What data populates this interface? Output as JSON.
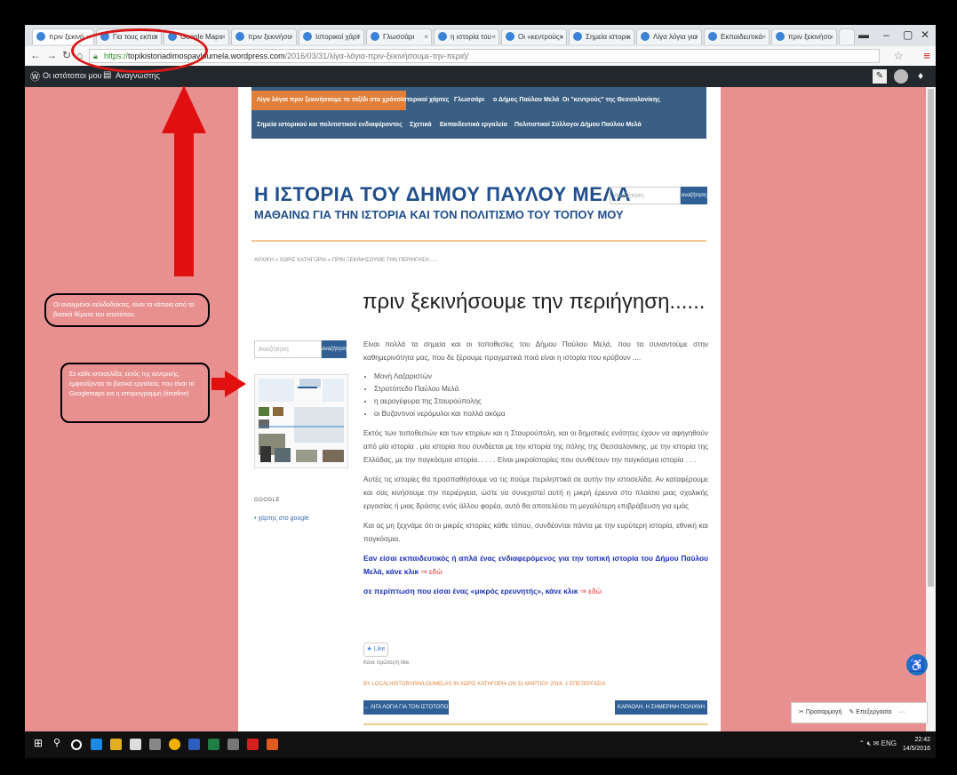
{
  "browser": {
    "tabs": [
      {
        "label": "πριν ξεκινή"
      },
      {
        "label": "Για τους εκπαι"
      },
      {
        "label": "Google Maps"
      },
      {
        "label": "πριν ξεκινήσο"
      },
      {
        "label": "Ιστορικοί χάρτ"
      },
      {
        "label": "Γλωσσάρι"
      },
      {
        "label": "η ιστορία του"
      },
      {
        "label": "Οι «κεντρούς»"
      },
      {
        "label": "Σημεία ιστορικ"
      },
      {
        "label": "Λίγα λόγια για"
      },
      {
        "label": "Εκπαιδευτικά"
      },
      {
        "label": "πριν ξεκινήσο"
      }
    ],
    "url_scheme": "https://",
    "url_host": "topikistoriadimospavloumela.wordpress.com",
    "url_path": "/2016/03/31/λίγα-λόγια-πριν-ξεκινήσουμε-την-περιή/"
  },
  "wpbar": {
    "my_sites": "Οι ιστότοποι μου",
    "reader": "Αναγνώστης"
  },
  "site": {
    "nav_row1": [
      "Λίγα λόγια πριν ξεκινήσουμε το ταξίδι στο χρόνο",
      "Ιστορικοί χάρτες",
      "Γλωσσάρι",
      "ο Δήμος Παύλου Μελά",
      "Οι \"κεντρούς\" της Θεσσαλονίκης"
    ],
    "nav_row2": [
      "Σημεία ιστορικού και πολιτιστικού ενδιαφέροντος",
      "Σχετικά",
      "Εκπαιδευτικά εργαλεία",
      "Πολιτιστικοί Σύλλογοι Δήμου Παύλου Μελά"
    ],
    "title": "Η ΙΣΤΟΡΙΑ ΤΟΥ ΔΗΜΟΥ ΠΑΥΛΟΥ ΜΕΛΑ",
    "tagline": "ΜΑΘΑΙΝΩ ΓΙΑ ΤΗΝ ΙΣΤΟΡΙΑ ΚΑΙ ΤΟΝ ΠΟΛΙΤΙΣΜΟ ΤΟΥ ΤΟΠΟΥ ΜΟΥ",
    "search_placeholder": "Αναζήτηση",
    "search_button": "αναζήτηση",
    "breadcrumb": "ΑΡΧΙΚΗ » ΧΩΡΙΣ ΚΑΤΗΓΟΡΙΑ » ΠΡΙΝ ΞΕΚΙΝΗΣΟΥΜΕ ΤΗΝ ΠΕΡΙΗΓΗΣΗ......"
  },
  "sidebar": {
    "search_placeholder": "Αναζήτηση",
    "search_button": "αναζήτηση",
    "google_heading": "GOOGLE",
    "google_link": "χάρτης στο google"
  },
  "post": {
    "title": "πριν ξεκινήσουμε την περιήγηση......",
    "p1": "Είναι πολλά τα σημεία και οι τοποθεσίες του Δήμου Παύλου Μελά, που τα συναντούμε στην καθημερινότητα μας, που δε ξέρουμε πραγματικά ποιά είναι η ιστορία που κρύβουν ....",
    "list": [
      "Μονή Λαζαριστών",
      "Στρατόπεδο Παύλου Μελά",
      "η αερογέφυρα της Σταυρούπολης",
      "οι Βυζαντινοί νερόμυλοι και πολλά ακόμα"
    ],
    "p2": "Εκτός των τοποθεσιών και των κτηρίων και η Σταυρούπολη, και οι δημοτικές ενότητες έχουν να αφηγηθούν από μία ιστορία . μία ιστορία που συνδέεται με την ιστορία της πόλης της Θεσσαλονίκης, με την ιστορία της Ελλάδας, με την παγκόσμια ιστορία. . . . . Είναι μικροϊστορίες που συνθέτουν την παγκόσμια ιστορία . . .",
    "p3": "Αυτές τις ιστορίες θα προσπαθήσουμε να τις πούμε περιληπτικά σε αυτήν την ιστοσελίδα. Αν καταφέρουμε και σας κινήσουμε την περιέργεια, ώστε να συνεχιστεί αυτή η μικρή έρευνα στο πλαίσιο μιας σχολικής εργασίας ή μιας δράσης ενός άλλου φορέα, αυτό θα αποτελέσει τη μεγαλύτερη επιβράβευση για εμάς",
    "p4": "Και ας μη ξεχνάμε ότι οι μικρές ιστορίες κάθε τόπου, συνδέονται πάντα με την ευρύτερη ιστορία, εθνική και παγκόσμια.",
    "cta1": "Εαν είσαι εκπαιδευτικός ή απλά ένας ενδιαφερόμενος για την τοπική ιστορία του Δήμου Παύλου Μελά, κάνε κλικ",
    "cta2": "σε περίπτωση που είσαι ένας «μικρός ερευνητής», κάνε κλικ",
    "here": "⇒ εδώ",
    "like": "Like",
    "likes_text": "Κάνε πρώτος/η like.",
    "byline": "BY LOCALHISTORYPAVLOUMELAS IN ΧΩΡΙΣ ΚΑΤΗΓΟΡΙΑ ON 31 ΜΑΡΤΙΟΥ 2016. 1 ΕΠΕΞΕΡΓΑΣΙΑ",
    "prev": "← ΛΙΓΑ ΛΟΓΙΑ ΓΙΑ ΤΟΝ ΙΣΤΟΤΟΠΟ",
    "next": "ΚΑΡΑΟΛΗ, Η ΣΗΜΕΡΙΝΗ ΠΟΛΙΧΝΗ →"
  },
  "wp_tools": {
    "customize": "Προσαρμογή",
    "edit": "Επεξεργασία"
  },
  "annotations": {
    "note1": "Οι ανοιγμένοι σελιδοδείκτες, είναι τα κάποια από τα βασικά θέματα του ιστοτόπου.",
    "note2": "Σε κάθε ιστοσελίδα, εκτός της κεντρικής, εμφανίζονται τα βασικά εργαλεία, που είναι τα Googlemaps και η ιστοριογραμμή (timeline)"
  },
  "taskbar": {
    "lang": "ENG",
    "time": "22:42",
    "date": "14/5/2016"
  }
}
